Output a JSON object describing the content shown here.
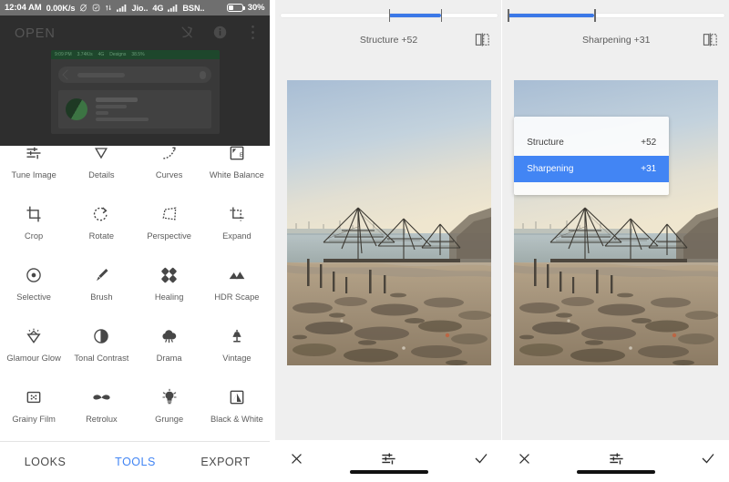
{
  "statusbar": {
    "clock": "12:04 AM",
    "netspeed": "0.00K/s",
    "icons": [
      "mute-icon",
      "alarm-icon",
      "vpn-icon",
      "signal-bars-icon",
      "signal-bars-icon-2",
      "battery-icon"
    ],
    "carrier1": "Jio..",
    "network_type": "4G",
    "carrier2": "BSN..",
    "battery_percent": "30%"
  },
  "left_panel": {
    "header": {
      "open_label": "OPEN",
      "icons": [
        "undo-history-icon",
        "info-icon",
        "overflow-menu-icon"
      ]
    },
    "tools": [
      {
        "label": "Tune Image",
        "icon": "tune-sliders-icon"
      },
      {
        "label": "Details",
        "icon": "details-triangle-icon"
      },
      {
        "label": "Curves",
        "icon": "curves-icon"
      },
      {
        "label": "White Balance",
        "icon": "white-balance-icon"
      },
      {
        "label": "Crop",
        "icon": "crop-icon"
      },
      {
        "label": "Rotate",
        "icon": "rotate-icon"
      },
      {
        "label": "Perspective",
        "icon": "perspective-icon"
      },
      {
        "label": "Expand",
        "icon": "expand-icon"
      },
      {
        "label": "Selective",
        "icon": "selective-target-icon"
      },
      {
        "label": "Brush",
        "icon": "brush-icon"
      },
      {
        "label": "Healing",
        "icon": "healing-bandage-icon"
      },
      {
        "label": "HDR Scape",
        "icon": "hdr-mountains-icon"
      },
      {
        "label": "Glamour Glow",
        "icon": "glamour-diamond-icon"
      },
      {
        "label": "Tonal Contrast",
        "icon": "tonal-contrast-circle-icon"
      },
      {
        "label": "Drama",
        "icon": "drama-cloud-icon"
      },
      {
        "label": "Vintage",
        "icon": "vintage-lamp-icon"
      },
      {
        "label": "Grainy Film",
        "icon": "grainy-film-icon"
      },
      {
        "label": "Retrolux",
        "icon": "retrolux-moustache-icon"
      },
      {
        "label": "Grunge",
        "icon": "grunge-bulb-icon"
      },
      {
        "label": "Black & White",
        "icon": "black-white-icon"
      }
    ],
    "tabs": [
      {
        "label": "LOOKS",
        "active": false
      },
      {
        "label": "TOOLS",
        "active": true
      },
      {
        "label": "EXPORT",
        "active": false
      }
    ]
  },
  "middle_panel": {
    "slider": {
      "label": "Structure +52",
      "value": 52,
      "fill_start_pct": 50,
      "fill_end_pct": 74
    },
    "compare_icon": "compare-split-icon",
    "bottom": {
      "cancel_icon": "close-x-icon",
      "adjust_icon": "tune-sliders-icon",
      "confirm_icon": "check-icon"
    }
  },
  "right_panel": {
    "slider": {
      "label": "Sharpening +31",
      "value": 31,
      "fill_start_pct": 0,
      "fill_end_pct": 40
    },
    "compare_icon": "compare-split-icon",
    "popup": {
      "items": [
        {
          "label": "Structure",
          "value": "+52",
          "selected": false
        },
        {
          "label": "Sharpening",
          "value": "+31",
          "selected": true
        }
      ]
    },
    "bottom": {
      "cancel_icon": "close-x-icon",
      "adjust_icon": "tune-sliders-icon",
      "confirm_icon": "check-icon"
    }
  },
  "colors": {
    "accent_blue": "#4285f4",
    "slider_blue": "#3b78e7",
    "panel_bg": "#efefef",
    "statusbar_bg": "#6f6f6f",
    "overlay_dark": "#2e2e2e"
  }
}
